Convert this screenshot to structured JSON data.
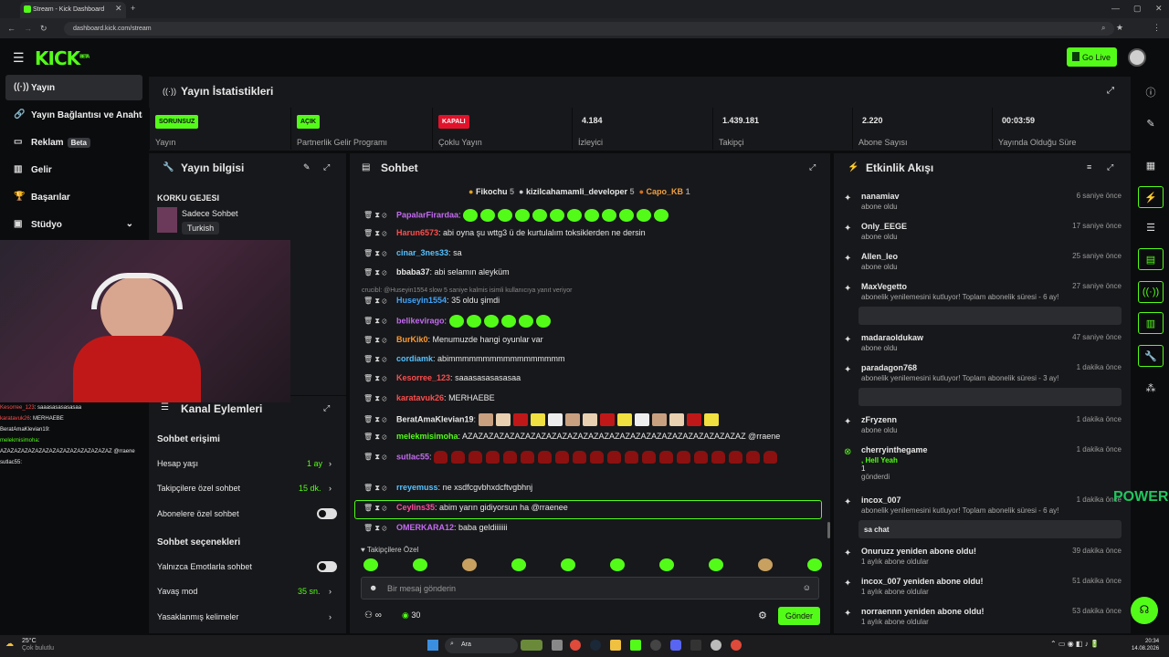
{
  "browser": {
    "tab_title": "Stream - Kick Dashboard",
    "url": "dashboard.kick.com/stream"
  },
  "header": {
    "logo": "KICK",
    "logo_tag": "BETA",
    "go_live": "Go Live"
  },
  "sidebar": {
    "items": [
      {
        "label": "Yayın",
        "icon": "stream-icon"
      },
      {
        "label": "Yayın Bağlantısı ve Anahtarı",
        "icon": "link-icon"
      },
      {
        "label": "Reklam",
        "icon": "ad-icon",
        "badge": "Beta"
      },
      {
        "label": "Gelir",
        "icon": "revenue-icon"
      },
      {
        "label": "Başarılar",
        "icon": "trophy-icon"
      },
      {
        "label": "Stüdyo",
        "icon": "studio-icon"
      }
    ]
  },
  "stats": {
    "title": "Yayın İstatistikleri",
    "cells": [
      {
        "badge": "SORUNSUZ",
        "label": "Yayın",
        "badge_color": "#53fc18"
      },
      {
        "badge": "AÇIK",
        "label": "Partnerlik Gelir Programı",
        "badge_color": "#53fc18"
      },
      {
        "badge": "KAPALI",
        "label": "Çoklu Yayın",
        "badge_color": "#e3122b"
      },
      {
        "value": "4.184",
        "label": "İzleyici"
      },
      {
        "value": "1.439.181",
        "label": "Takipçi"
      },
      {
        "value": "2.220",
        "label": "Abone Sayısı"
      },
      {
        "value": "00:03:59",
        "label": "Yayında Olduğu Süre"
      }
    ]
  },
  "info": {
    "title": "Yayın bilgisi",
    "category_title": "KORKU GEJESI",
    "mode": "Sadece Sohbet",
    "language": "Turkish"
  },
  "channel": {
    "title": "Kanal Eylemleri",
    "access_title": "Sohbet erişimi",
    "rows": [
      {
        "label": "Hesap yaşı",
        "value": "1 ay"
      },
      {
        "label": "Takipçilere özel sohbet",
        "value": "15 dk."
      },
      {
        "label": "Abonelere özel sohbet"
      }
    ],
    "options_title": "Sohbet seçenekleri",
    "options": [
      {
        "label": "Yalnızca Emotlarla sohbet"
      },
      {
        "label": "Yavaş mod",
        "value": "35 sn."
      },
      {
        "label": "Yasaklanmış kelimeler"
      }
    ]
  },
  "chat": {
    "title": "Sohbet",
    "top_gifters": [
      {
        "name": "Fikochu",
        "count": "5"
      },
      {
        "name": "kizilcahamamli_developer",
        "count": "5"
      },
      {
        "name": "Capo_KB",
        "count": "1"
      }
    ],
    "messages": [
      {
        "user": "PapalarFirardaa",
        "color": "#c36cf0",
        "text": "",
        "emotes": 12
      },
      {
        "user": "Harun6573",
        "color": "#ff4d4d",
        "text": "abi oyna şu wttg3 ü de kurtulalım toksiklerden ne dersin"
      },
      {
        "user": "cinar_3nes33",
        "color": "#56c2ff",
        "text": "sa"
      },
      {
        "user": "bbaba37",
        "color": "#e8e8e8",
        "text": "abi selamın aleyküm"
      },
      {
        "user": "Huseyin1554",
        "color": "#3fa6ff",
        "text": "35 oldu şimdi"
      },
      {
        "user": "belikevirago",
        "color": "#c36cf0",
        "text": "",
        "emotes": 6
      },
      {
        "user": "BurKik0",
        "color": "#ff9a2e",
        "text": "Menumuzde hangi oyunlar var"
      },
      {
        "user": "cordiamk",
        "color": "#56c2ff",
        "text": "abimmmmmmmmmmmmmmmmm"
      },
      {
        "user": "Kesorree_123",
        "color": "#ff4d4d",
        "text": "saaasasasasasaa"
      },
      {
        "user": "karatavuk26",
        "color": "#ff4d4d",
        "text": "MERHAEBE"
      },
      {
        "user": "BeratAmaKlevian19",
        "color": "#e8e8e8",
        "text": "",
        "emotes": 14
      },
      {
        "user": "melekmisimoha",
        "color": "#53fc18",
        "text": "AZAZAZAZAZAZAZAZAZAZAZAZAZAZAZAZAZAZAZAZAZAZAZAZAZAZAZ @rraene"
      },
      {
        "user": "sutlac55",
        "color": "#c36cf0",
        "text": "",
        "emotes": 0
      },
      {
        "user": "rreyemuss",
        "color": "#56c2ff",
        "text": "ne xsdfcgvbhxdcftvgbhnj"
      },
      {
        "user": "Ceylins35",
        "color": "#ff4d9d",
        "text": "abim yarın gidiyorsun ha @rraenee"
      },
      {
        "user": "OMERKARA12",
        "color": "#c36cf0",
        "text": "baba geldiiiiiii"
      }
    ],
    "reply_note": "crucibl: @Huseyin1554 slow 5 saniye kalmis isimli kullanıcıya yanıt veriyor",
    "followers_only": "Takipçilere Özel",
    "input_placeholder": "Bir mesaj gönderin",
    "points": "30",
    "send": "Gönder"
  },
  "events": {
    "title": "Etkinlik Akışı",
    "items": [
      {
        "name": "nanamiav",
        "sub": "abone oldu",
        "time": "6 saniye önce"
      },
      {
        "name": "Only_EEGE",
        "sub": "abone oldu",
        "time": "17 saniye önce"
      },
      {
        "name": "Allen_leo",
        "sub": "abone oldu",
        "time": "25 saniye önce"
      },
      {
        "name": "MaxVegetto",
        "sub": "abonelik yenilemesini kutluyor! Toplam abonelik süresi - 6 ay!",
        "time": "27 saniye önce"
      },
      {
        "name": "madaraoldukaw",
        "sub": "abone oldu",
        "time": "47 saniye önce"
      },
      {
        "name": "paradagon768",
        "sub": "abonelik yenilemesini kutluyor! Toplam abonelik süresi - 3 ay!",
        "time": "1 dakika önce"
      },
      {
        "name": "zFryzenn",
        "sub": "abone oldu",
        "time": "1 dakika önce"
      },
      {
        "name": "cherryinthegame",
        "sub": ", Hell Yeah",
        "extra": "1",
        "sub2": "gönderdi",
        "time": "1 dakika önce"
      },
      {
        "name": "incox_007",
        "sub": "abonelik yenilemesini kutluyor! Toplam abonelik süresi - 6 ay!",
        "box": "sa chat",
        "time": "1 dakika önce"
      },
      {
        "name": "Onuruzz yeniden abone oldu!",
        "sub": "1 aylık abone oldular",
        "time": "39 dakika önce"
      },
      {
        "name": "incox_007 yeniden abone oldu!",
        "sub": "1 aylık abone oldular",
        "time": "51 dakika önce"
      },
      {
        "name": "norraennn yeniden abone oldu!",
        "sub": "1 aylık abone oldular",
        "time": "53 dakika önce"
      }
    ]
  },
  "overlay": {
    "power_text": "POWER",
    "cam_chat": [
      {
        "user": "Kesorree_123",
        "text": "saaasasasasasaa"
      },
      {
        "user": "karatavuk26",
        "text": "MERHAEBE"
      },
      {
        "user": "BeratAmaKlevian19",
        "text": ""
      },
      {
        "user": "melekmisimoha",
        "text": "AZAZAZAZAZAZAZAZAZAZAZAZAZAZAZAZ @rraene"
      },
      {
        "user": "sutlac55",
        "text": ""
      }
    ]
  },
  "taskbar": {
    "weather_temp": "25°C",
    "weather_desc": "Çok bulutlu",
    "search": "Ara",
    "time": "20:34",
    "date": "14.08.2026"
  }
}
